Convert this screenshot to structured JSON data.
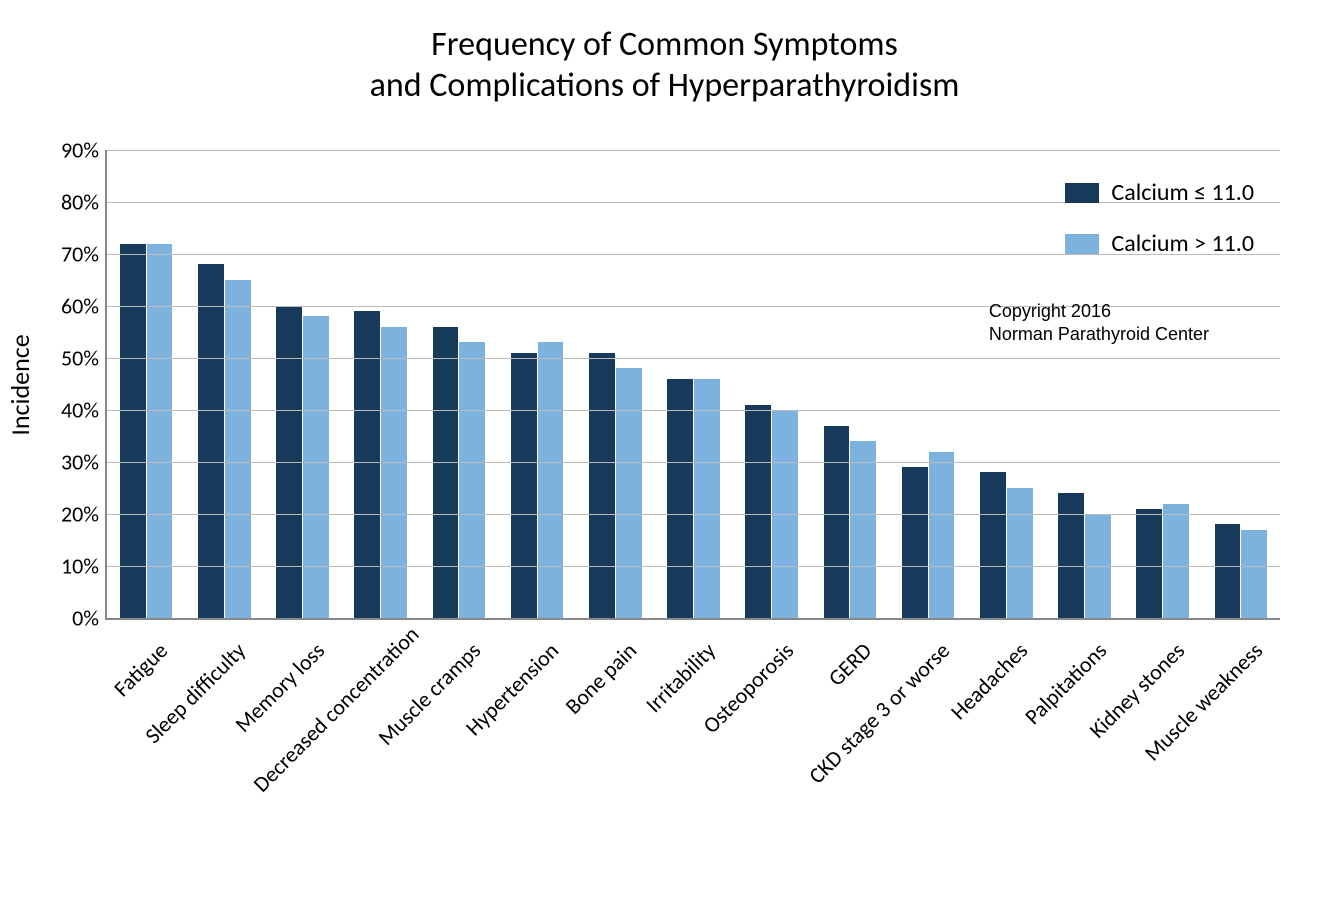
{
  "chart_data": {
    "type": "bar",
    "title": "Frequency of Common Symptoms\nand Complications of Hyperparathyroidism",
    "ylabel": "Incidence",
    "xlabel": "",
    "ylim": [
      0,
      90
    ],
    "y_ticks": [
      0,
      10,
      20,
      30,
      40,
      50,
      60,
      70,
      80,
      90
    ],
    "y_tick_labels": [
      "0%",
      "10%",
      "20%",
      "30%",
      "40%",
      "50%",
      "60%",
      "70%",
      "80%",
      "90%"
    ],
    "categories": [
      "Fatigue",
      "Sleep difficulty",
      "Memory loss",
      "Decreased concentration",
      "Muscle cramps",
      "Hypertension",
      "Bone pain",
      "Irritability",
      "Osteoporosis",
      "GERD",
      "CKD stage 3 or worse",
      "Headaches",
      "Palpitations",
      "Kidney stones",
      "Muscle weakness"
    ],
    "series": [
      {
        "name": "Calcium ≤ 11.0",
        "color": "#183a5a",
        "values": [
          72,
          68,
          60,
          59,
          56,
          51,
          51,
          46,
          41,
          37,
          29,
          28,
          24,
          21,
          18
        ]
      },
      {
        "name": "Calcium > 11.0",
        "color": "#7db2de",
        "values": [
          72,
          65,
          58,
          56,
          53,
          53,
          48,
          46,
          40,
          34,
          32,
          25,
          20,
          22,
          17
        ]
      }
    ],
    "copyright": "Copyright 2016\nNorman Parathyroid Center"
  }
}
